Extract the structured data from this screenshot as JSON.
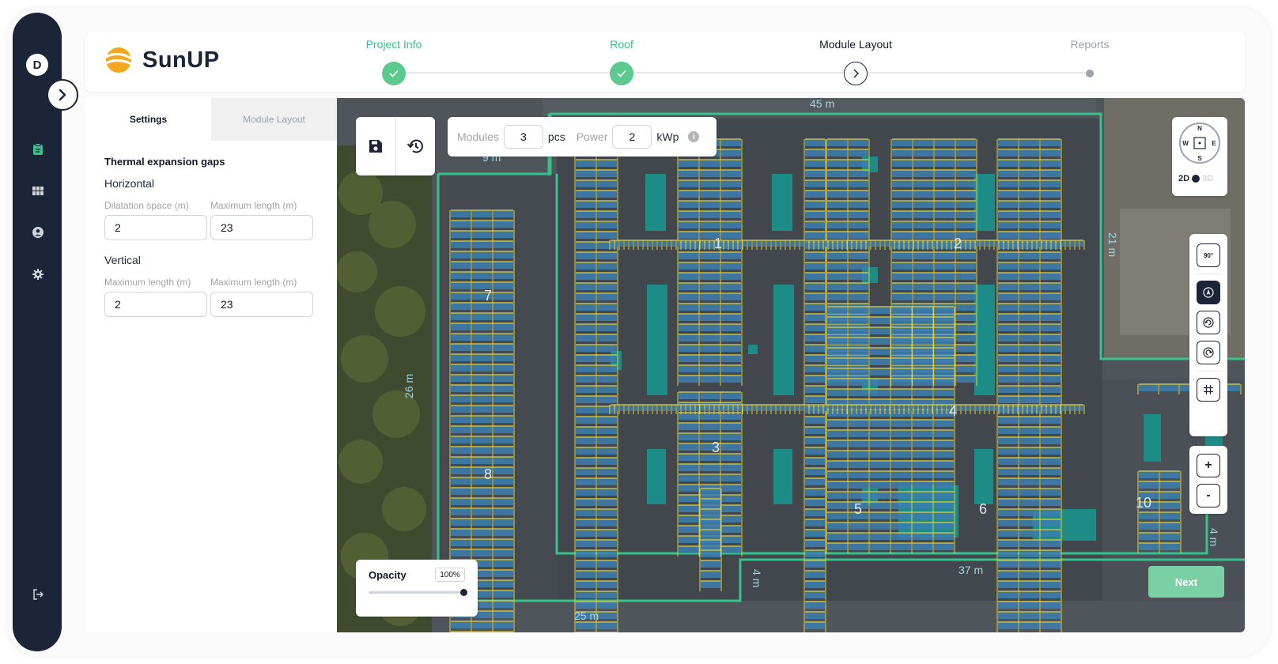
{
  "sidebar": {
    "avatar_initial": "D",
    "icons": [
      "expand-chevron-icon",
      "clipboard-icon",
      "grid-icon",
      "user-icon",
      "gear-icon",
      "logout-icon"
    ]
  },
  "header": {
    "brand": "SunUP",
    "steps": [
      {
        "label": "Project Info",
        "state": "done"
      },
      {
        "label": "Roof",
        "state": "done"
      },
      {
        "label": "Module Layout",
        "state": "current"
      },
      {
        "label": "Reports",
        "state": "pending"
      }
    ]
  },
  "panel": {
    "tabs": [
      {
        "label": "Settings",
        "active": true
      },
      {
        "label": "Module Layout",
        "active": false
      }
    ],
    "section_title": "Thermal expansion gaps",
    "horizontal": {
      "title": "Horizontal",
      "label_a": "Dilatation space (m)",
      "label_b": "Maximum length (m)",
      "value_a": "2",
      "value_b": "23"
    },
    "vertical": {
      "title": "Vertical",
      "label_a": "Maximum length (m)",
      "label_b": "Maximum length (m)",
      "value_a": "2",
      "value_b": "23"
    }
  },
  "map": {
    "modules_label": "Modules",
    "modules_value": "3",
    "modules_unit": "pcs",
    "power_label": "Power",
    "power_value": "2",
    "power_unit": "kWp",
    "compass": {
      "n": "N",
      "s": "S",
      "e": "E",
      "w": "W"
    },
    "view_2d": "2D",
    "view_3d": "3D",
    "rotate_label": "90°",
    "zoom_in": "+",
    "zoom_out": "-",
    "opacity_label": "Opacity",
    "opacity_value": "100%",
    "opacity_level": 1.0,
    "next_label": "Next",
    "dimensions": [
      "45 m",
      "9 m",
      "21 m",
      "26 m",
      "37 m",
      "4 m",
      "25 m",
      "4 m"
    ],
    "array_labels": [
      "1",
      "2",
      "3",
      "4",
      "5",
      "6",
      "7",
      "8",
      "10"
    ],
    "colors": {
      "outline": "#36c28a",
      "module": "#3b7fb0",
      "rail": "#e3cf3a",
      "obstacle": "#1e8c86"
    }
  }
}
